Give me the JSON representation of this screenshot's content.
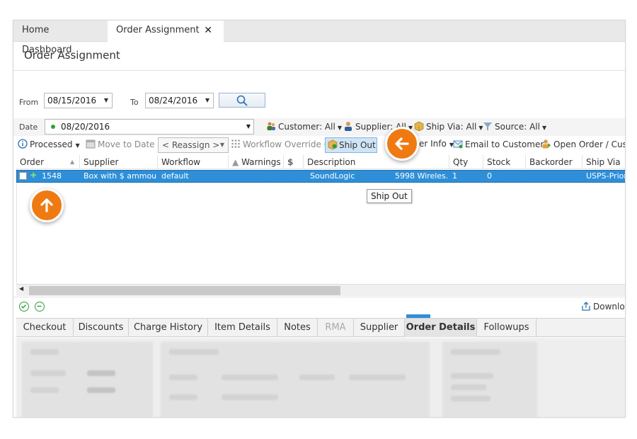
{
  "tabs": [
    {
      "label": "Home Dashboard"
    },
    {
      "label": "Order Assignment",
      "close": "✕"
    }
  ],
  "page_title": "Order Assignment",
  "filters": {
    "from_label": "From",
    "from_value": "08/15/2016",
    "to_label": "To",
    "to_value": "08/24/2016",
    "date_label": "Date",
    "date_value": "08/20/2016",
    "customer": "Customer: All",
    "supplier": "Supplier: All",
    "ship_via": "Ship Via: All",
    "source": "Source: All"
  },
  "toolbar": {
    "processed": "Processed",
    "move_to_date": "Move to Date",
    "reassign": "< Reassign >",
    "workflow_override": "Workflow Override",
    "ship_out": "Ship Out",
    "order_info": "er Info",
    "email_to_customer": "Email to Customer",
    "open_order": "Open Order / Cust"
  },
  "grid": {
    "columns": [
      "Order",
      "Supplier",
      "Workflow",
      "Warnings",
      "$",
      "Description",
      "Qty",
      "Stock",
      "Backorder",
      "Ship Via"
    ],
    "rows": [
      {
        "order": "1548",
        "supplier": "Box with $ ammou…",
        "workflow": "default",
        "description_a": "SoundLogic",
        "description_b": "5998 Wireles…",
        "qty": "1",
        "stock": "0",
        "ship_via": "USPS-Priori"
      }
    ]
  },
  "tooltip": "Ship Out",
  "status": {
    "download": "Downlo"
  },
  "bottom_tabs": [
    {
      "label": "Checkout"
    },
    {
      "label": "Discounts"
    },
    {
      "label": "Charge History"
    },
    {
      "label": "Item Details"
    },
    {
      "label": "Notes"
    },
    {
      "label": "RMA"
    },
    {
      "label": "Supplier"
    },
    {
      "label": "Order Details"
    },
    {
      "label": "Followups"
    }
  ],
  "colors": {
    "selection": "#2e8fd8",
    "callout": "#f07a12",
    "ship_out_button": "#cfe4f7"
  }
}
